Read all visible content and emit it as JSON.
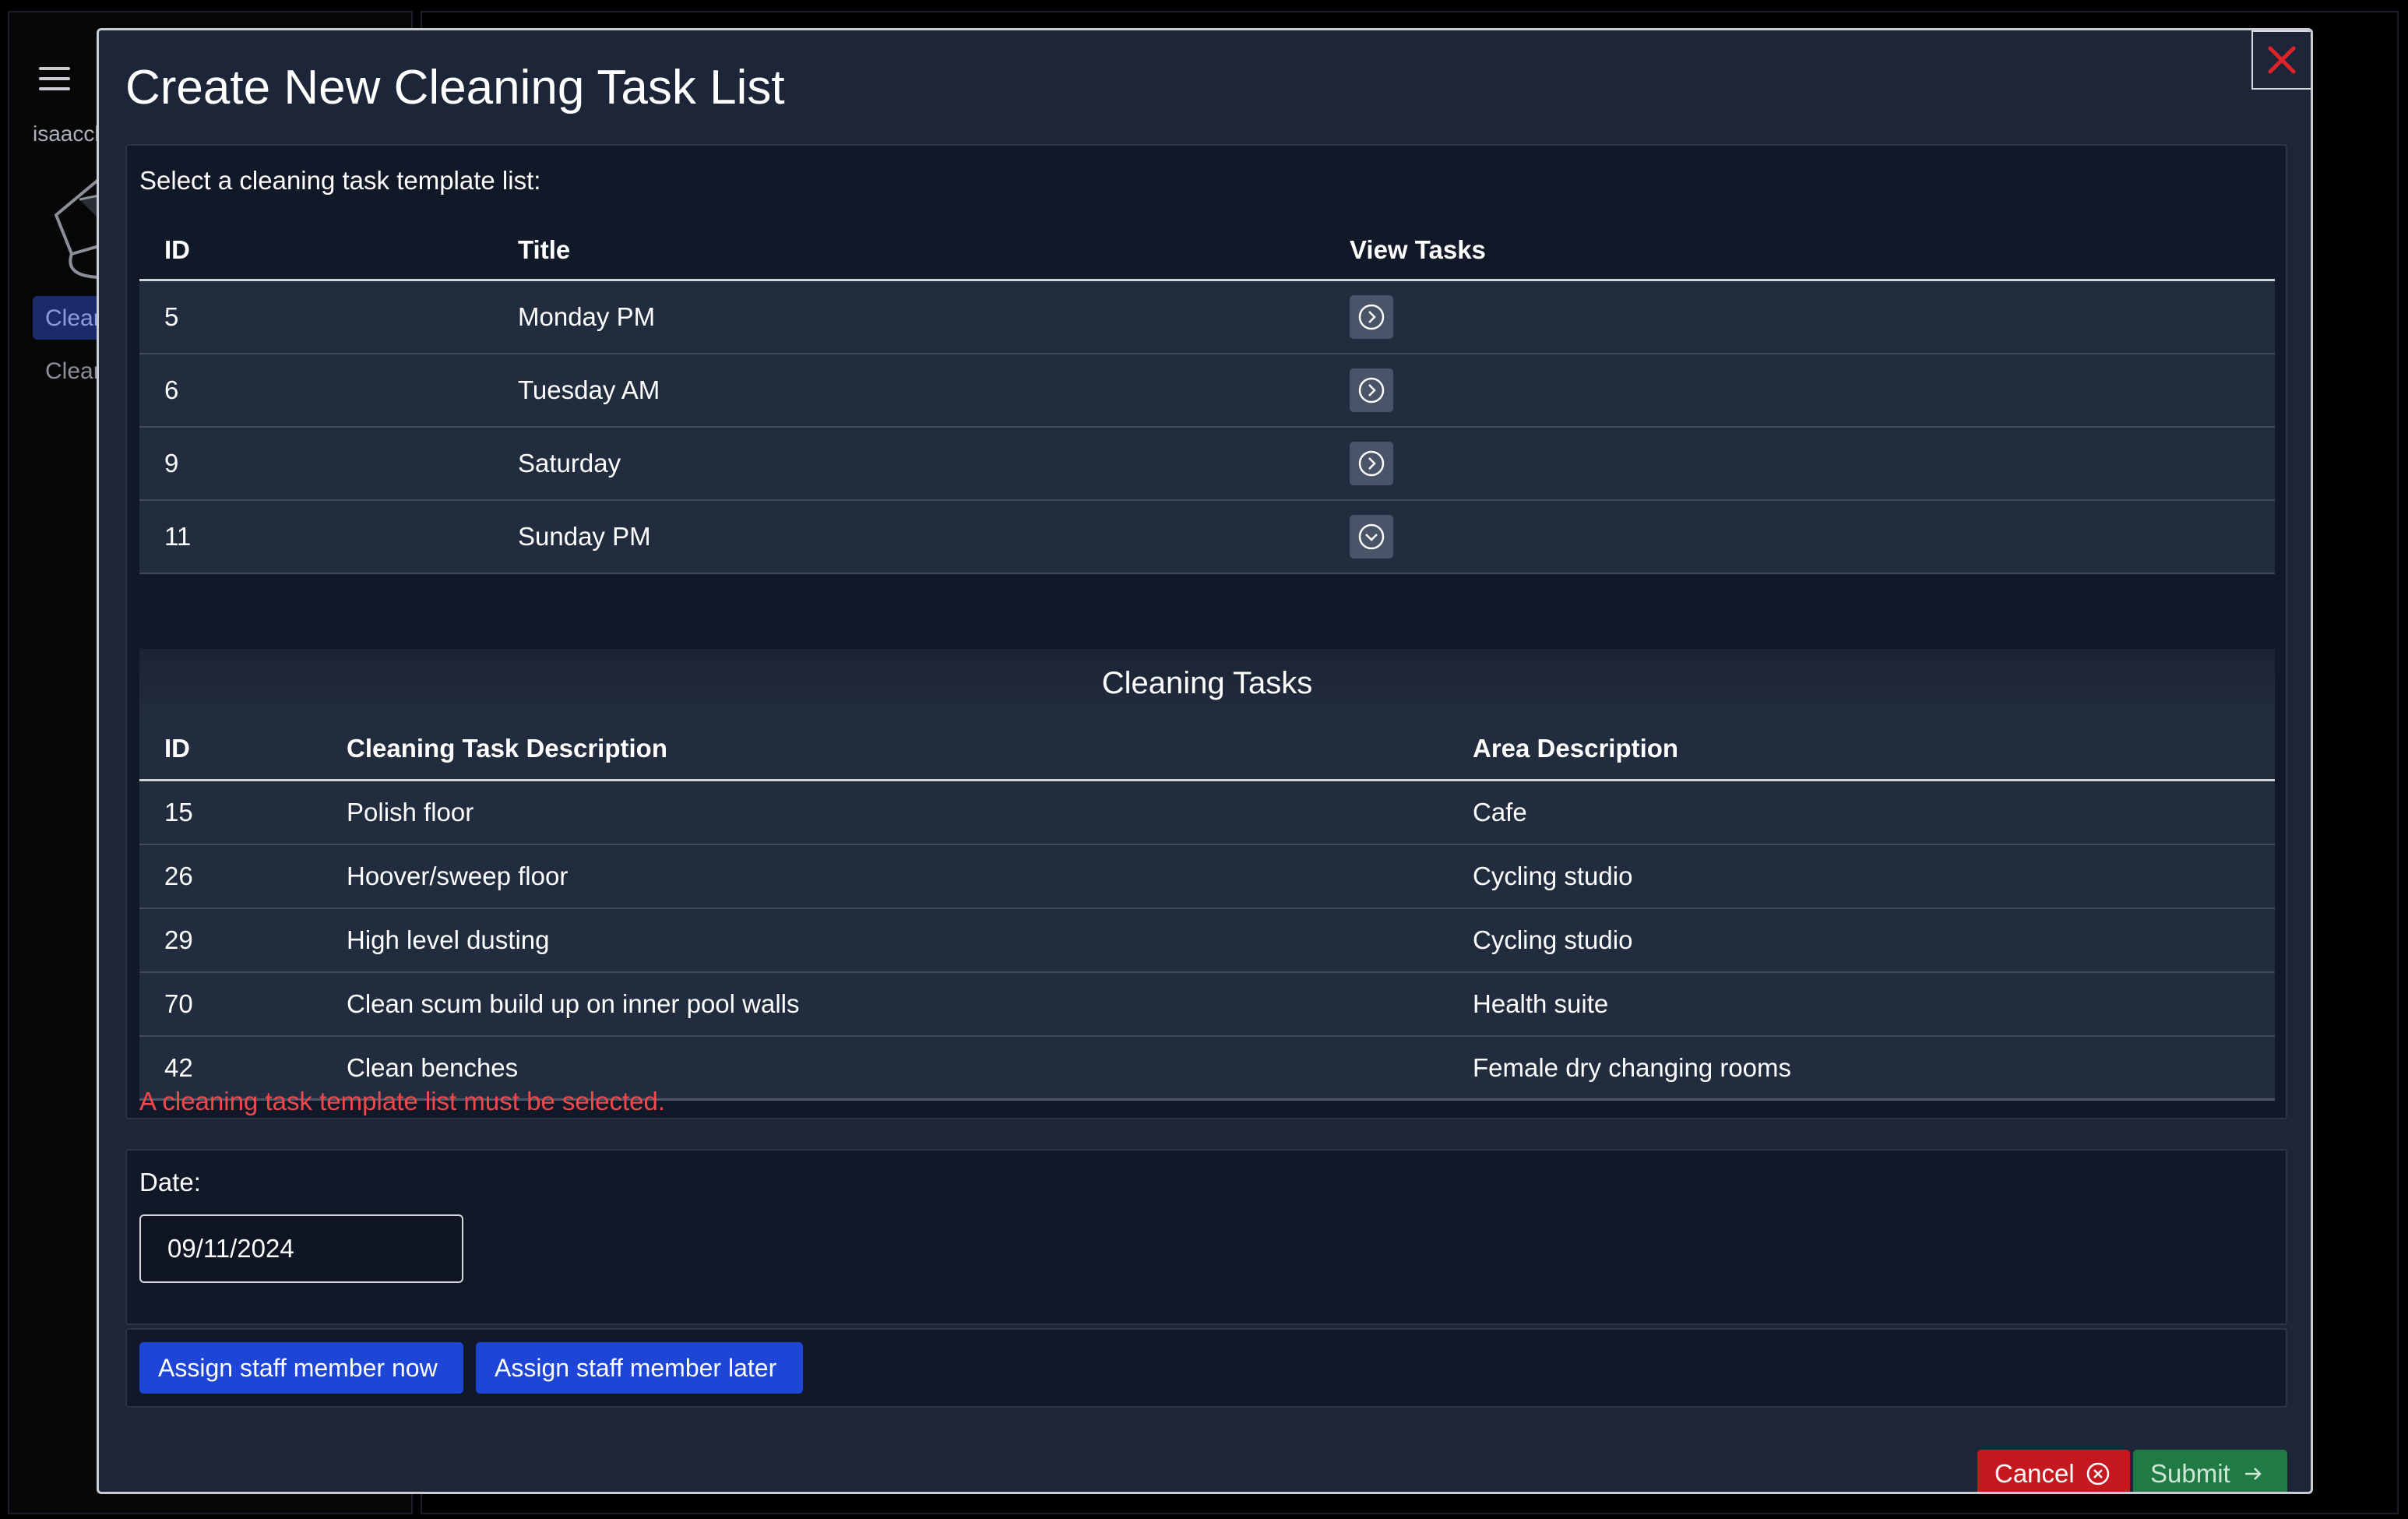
{
  "background": {
    "username": "isaaccl",
    "nav_items": [
      "Clean",
      "Clean"
    ]
  },
  "modal": {
    "title": "Create New Cleaning Task List",
    "close_icon": "close-x-icon",
    "accent_colors": {
      "close": "#e0232b",
      "primary": "#1d45d6",
      "danger": "#c6191f",
      "success": "#1f7a44",
      "error_text": "#f0484b"
    }
  },
  "templates": {
    "prompt": "Select a cleaning task template list:",
    "headers": [
      "ID",
      "Title",
      "View Tasks"
    ],
    "rows": [
      {
        "id": "5",
        "title": "Monday PM",
        "icon": "chevron-right-circle-icon"
      },
      {
        "id": "6",
        "title": "Tuesday AM",
        "icon": "chevron-right-circle-icon"
      },
      {
        "id": "9",
        "title": "Saturday",
        "icon": "chevron-right-circle-icon"
      },
      {
        "id": "11",
        "title": "Sunday PM",
        "icon": "chevron-down-circle-icon"
      }
    ]
  },
  "tasks": {
    "caption": "Cleaning Tasks",
    "headers": [
      "ID",
      "Cleaning Task Description",
      "Area Description"
    ],
    "rows": [
      {
        "id": "15",
        "description": "Polish floor",
        "area": "Cafe"
      },
      {
        "id": "26",
        "description": "Hoover/sweep floor",
        "area": "Cycling studio"
      },
      {
        "id": "29",
        "description": "High level dusting",
        "area": "Cycling studio"
      },
      {
        "id": "70",
        "description": "Clean scum build up on inner pool walls",
        "area": "Health suite"
      },
      {
        "id": "42",
        "description": "Clean benches",
        "area": "Female dry changing rooms"
      }
    ]
  },
  "validation": {
    "error": "A cleaning task template list must be selected."
  },
  "date": {
    "label": "Date:",
    "value": "09/11/2024"
  },
  "assign": {
    "now_label": "Assign staff member now",
    "later_label": "Assign staff member later"
  },
  "footer": {
    "cancel_label": "Cancel",
    "cancel_icon": "x-circle-icon",
    "submit_label": "Submit",
    "submit_icon": "arrow-right-icon"
  }
}
